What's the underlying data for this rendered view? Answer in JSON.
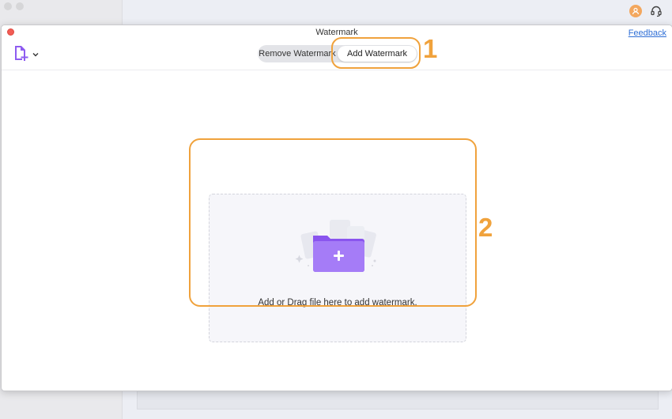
{
  "window": {
    "title": "Watermark",
    "feedback_label": "Feedback"
  },
  "toolbar": {
    "add_file_icon": "add-document-icon",
    "tabs": [
      {
        "label": "Remove Watermark",
        "active": false
      },
      {
        "label": "Add Watermark",
        "active": true
      }
    ]
  },
  "dropzone": {
    "text": "Add or Drag file here to add watermark.",
    "icon": "folder-add-icon"
  },
  "annotations": {
    "step1": "1",
    "step2": "2",
    "color": "#f0a23c"
  },
  "colors": {
    "accent_purple": "#9b6cf2",
    "close_red": "#f25c54",
    "link_blue": "#2f6fd6"
  }
}
